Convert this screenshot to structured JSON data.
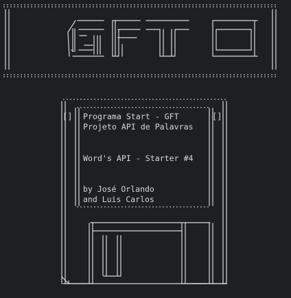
{
  "terminal": {
    "header_logo": "GFT",
    "disk_brackets": {
      "left": "[]",
      "right": "[]"
    },
    "label_lines": {
      "line1": "Programa Start - GFT",
      "line2": "Projeto API de Palavras",
      "line3": "Word's API - Starter #4",
      "line4": "by José Orlando",
      "line5": "and Luis Carlos"
    }
  },
  "colors": {
    "background": "#1e1f22",
    "foreground": "#d6d6d6"
  }
}
